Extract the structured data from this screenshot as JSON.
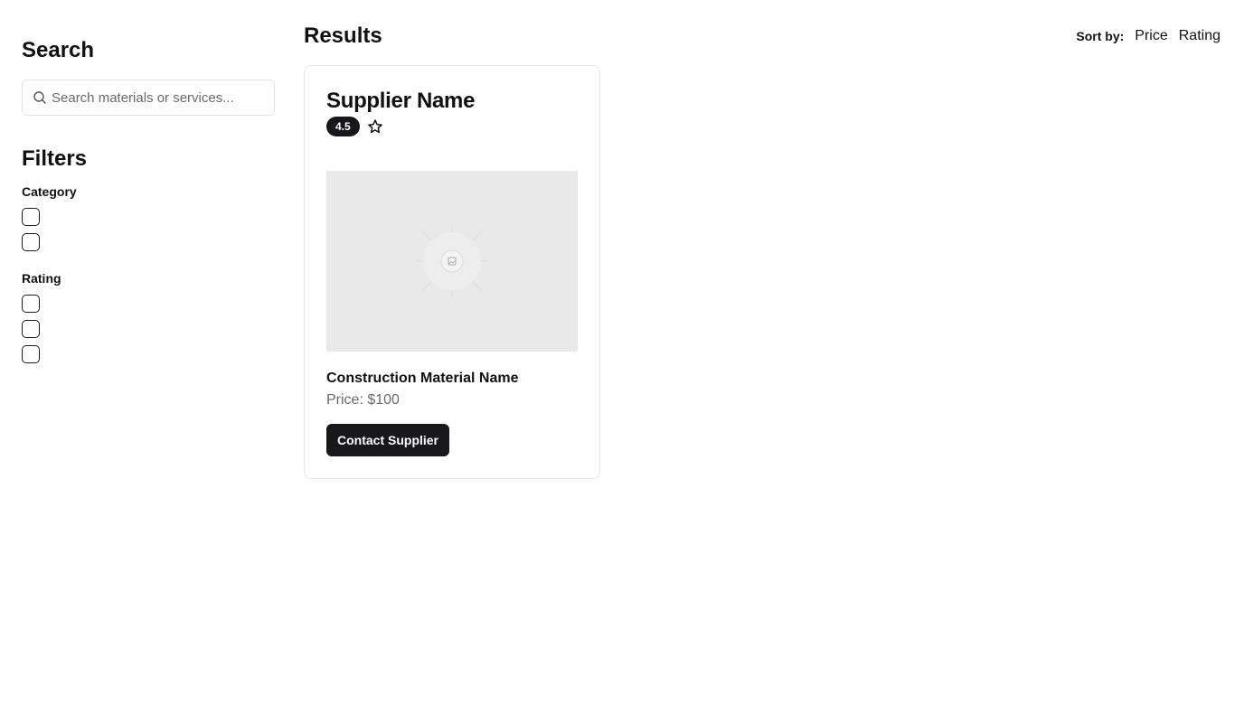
{
  "sidebar": {
    "search_heading": "Search",
    "search_placeholder": "Search materials or services...",
    "search_value": "",
    "filters_heading": "Filters",
    "category_label": "Category",
    "category_options_count": 2,
    "rating_label": "Rating",
    "rating_options_count": 3
  },
  "main": {
    "results_heading": "Results",
    "sort_label": "Sort by:",
    "sort_options": [
      "Price",
      "Rating"
    ]
  },
  "results": [
    {
      "supplier_name": "Supplier Name",
      "rating": "4.5",
      "rating_icon": "star-outline-icon",
      "image_icon": "image-placeholder-icon",
      "material_name": "Construction Material Name",
      "price": "Price: $100",
      "contact_label": "Contact Supplier"
    }
  ],
  "colors": {
    "primary": "#18181b",
    "muted_text": "#6b6b6b",
    "border": "#e5e5e5",
    "image_bg": "#e9e9e9"
  }
}
